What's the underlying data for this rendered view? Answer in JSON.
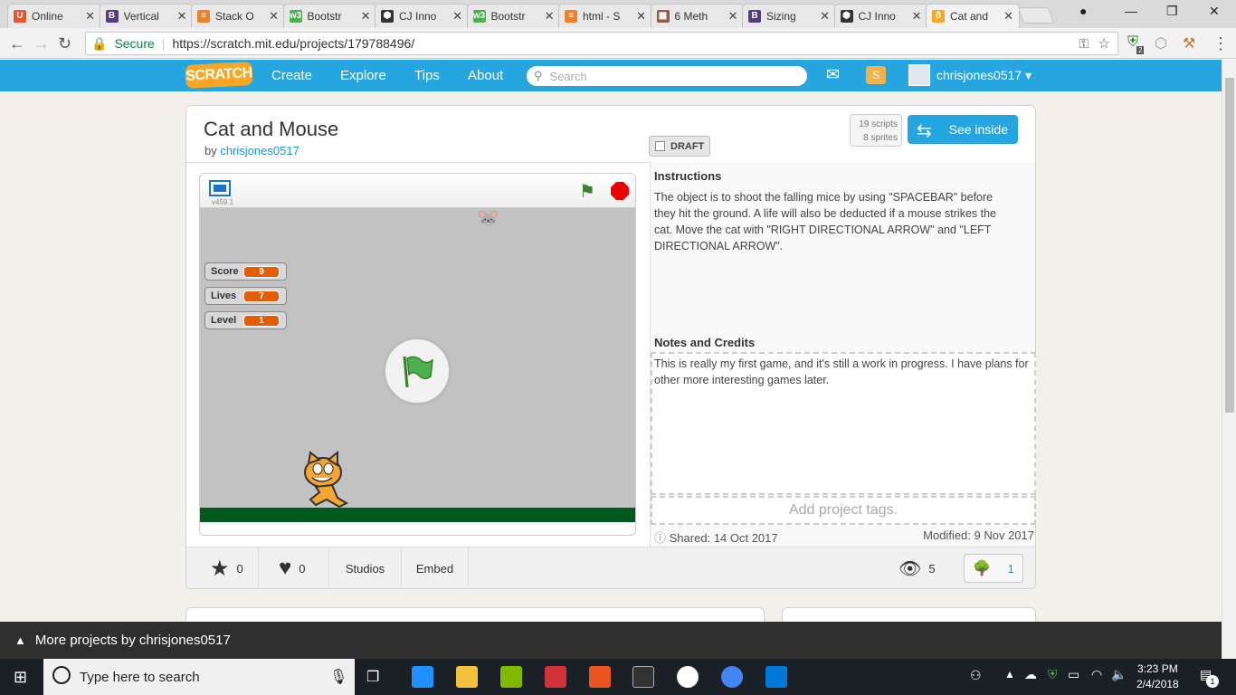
{
  "browser": {
    "tabs": [
      {
        "label": "Online",
        "icon": "U",
        "color": "#e4572e"
      },
      {
        "label": "Vertical",
        "icon": "B",
        "color": "#563d7c"
      },
      {
        "label": "Stack O",
        "icon": "≡",
        "color": "#f48024"
      },
      {
        "label": "Bootstr",
        "icon": "w3",
        "color": "#4caf50"
      },
      {
        "label": "CJ Inno",
        "icon": "⬢",
        "color": "#333333"
      },
      {
        "label": "Bootstr",
        "icon": "w3",
        "color": "#4caf50"
      },
      {
        "label": "html - S",
        "icon": "≡",
        "color": "#f48024"
      },
      {
        "label": "6 Meth",
        "icon": "▦",
        "color": "#8d5b4c"
      },
      {
        "label": "Sizing",
        "icon": "B",
        "color": "#563d7c"
      },
      {
        "label": "CJ Inno",
        "icon": "⬢",
        "color": "#333333"
      },
      {
        "label": "Cat and",
        "icon": "β",
        "color": "#f9a722"
      }
    ],
    "secure_label": "Secure",
    "url_host": "https://scratch.mit.edu",
    "url_path": "/projects/179788496/",
    "ext_badge": "2"
  },
  "nav": {
    "logo": "SCRATCH",
    "links": [
      "Create",
      "Explore",
      "Tips",
      "About"
    ],
    "search_placeholder": "Search",
    "username": "chrisjones0517"
  },
  "project": {
    "title": "Cat and Mouse",
    "by_label": "by",
    "author": "chrisjones0517",
    "scripts": "19 scripts",
    "sprites": "8 sprites",
    "see_inside": "See inside",
    "draft_label": "DRAFT",
    "version": "v459.1",
    "monitors": [
      {
        "label": "Score",
        "value": "9"
      },
      {
        "label": "Lives",
        "value": "7"
      },
      {
        "label": "Level",
        "value": "1"
      }
    ],
    "instructions_heading": "Instructions",
    "instructions": "The object is to shoot the falling mice by using \"SPACEBAR\" before they hit the ground. A life will also be deducted if a mouse strikes the cat. Move the cat with \"RIGHT DIRECTIONAL ARROW\" and \"LEFT DIRECTIONAL ARROW\".",
    "notes_heading": "Notes and Credits",
    "notes": "This is really my first game, and it's still a work in progress. I have plans for other more interesting games later.",
    "tags_placeholder": "Add project tags.",
    "shared": "Shared: 14 Oct 2017",
    "modified": "Modified: 9 Nov 2017",
    "stars": "0",
    "loves": "0",
    "studios_label": "Studios",
    "embed_label": "Embed",
    "views": "5",
    "remixes": "1"
  },
  "more_projects": "More projects by chrisjones0517",
  "taskbar": {
    "search_placeholder": "Type here to search",
    "time": "3:23 PM",
    "date": "2/4/2018",
    "notif": "1"
  }
}
